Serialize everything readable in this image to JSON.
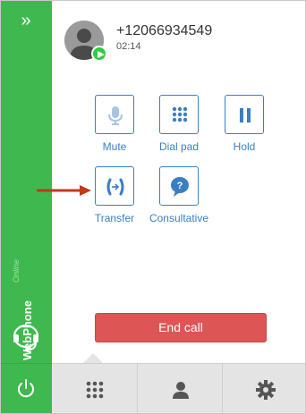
{
  "call": {
    "number": "+12066934549",
    "duration": "02:14"
  },
  "actions": {
    "mute": "Mute",
    "dial_pad": "Dial pad",
    "hold": "Hold",
    "transfer": "Transfer",
    "consultative": "Consultative"
  },
  "end_call_label": "End call",
  "sidebar": {
    "label": "WebPhone",
    "status": "Online",
    "expand_glyph": "»"
  },
  "icons": {
    "expand": "double-chevron-right-icon",
    "avatar": "user-avatar-icon",
    "badge": "play-icon",
    "mute": "microphone-muted-icon",
    "dial_pad": "keypad-icon",
    "hold": "pause-icon",
    "transfer": "transfer-call-icon",
    "consultative": "question-bubble-icon",
    "headset": "headset-icon",
    "power": "power-icon",
    "tab_dialpad": "keypad-icon",
    "tab_contacts": "person-icon",
    "tab_settings": "gear-icon"
  },
  "colors": {
    "sidebar_green": "#3fb94f",
    "accent_blue": "#3a7fc4",
    "end_call_red": "#dd5555",
    "arrow": "#c0391b"
  }
}
